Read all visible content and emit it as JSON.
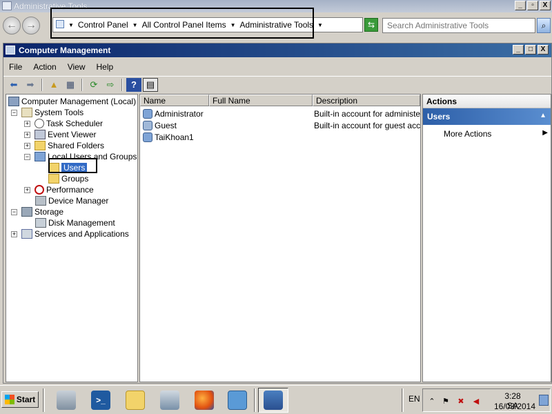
{
  "outer_window": {
    "title": "Administrative Tools",
    "controls": {
      "minimize": "_",
      "maximize": "▫",
      "close": "X"
    }
  },
  "address_bar": {
    "breadcrumbs": [
      "Control Panel",
      "All Control Panel Items",
      "Administrative Tools"
    ],
    "search_placeholder": "Search Administrative Tools"
  },
  "cm_window": {
    "title": "Computer Management",
    "controls": {
      "minimize": "_",
      "maximize": "□",
      "close": "X"
    },
    "menu": [
      "File",
      "Action",
      "View",
      "Help"
    ],
    "toolbar": [
      "back-icon",
      "forward-icon",
      "up-folder-icon",
      "show-hide-tree-icon",
      "refresh-icon",
      "export-list-icon",
      "help-icon",
      "action-pane-icon"
    ]
  },
  "tree": {
    "root": "Computer Management (Local)",
    "system_tools": "System Tools",
    "task_scheduler": "Task Scheduler",
    "event_viewer": "Event Viewer",
    "shared_folders": "Shared Folders",
    "local_users_groups": "Local Users and Groups",
    "users": "Users",
    "groups": "Groups",
    "performance": "Performance",
    "device_manager": "Device Manager",
    "storage": "Storage",
    "disk_management": "Disk Management",
    "services_apps": "Services and Applications"
  },
  "list": {
    "columns": [
      "Name",
      "Full Name",
      "Description"
    ],
    "rows": [
      {
        "name": "Administrator",
        "full_name": "",
        "description": "Built-in account for administerir"
      },
      {
        "name": "Guest",
        "full_name": "",
        "description": "Built-in account for guest acce:"
      },
      {
        "name": "TaiKhoan1",
        "full_name": "",
        "description": ""
      }
    ]
  },
  "actions": {
    "header": "Actions",
    "section": "Users",
    "more_actions": "More Actions"
  },
  "taskbar": {
    "start_label": "Start",
    "apps": [
      "server-manager-icon",
      "powershell-icon",
      "windows-explorer-icon",
      "admin-tools-icon",
      "firefox-icon",
      "control-panel-icon",
      "computer-management-icon"
    ],
    "language": "EN",
    "clock_time": "3:28 SA",
    "clock_date": "16/03/2014"
  }
}
